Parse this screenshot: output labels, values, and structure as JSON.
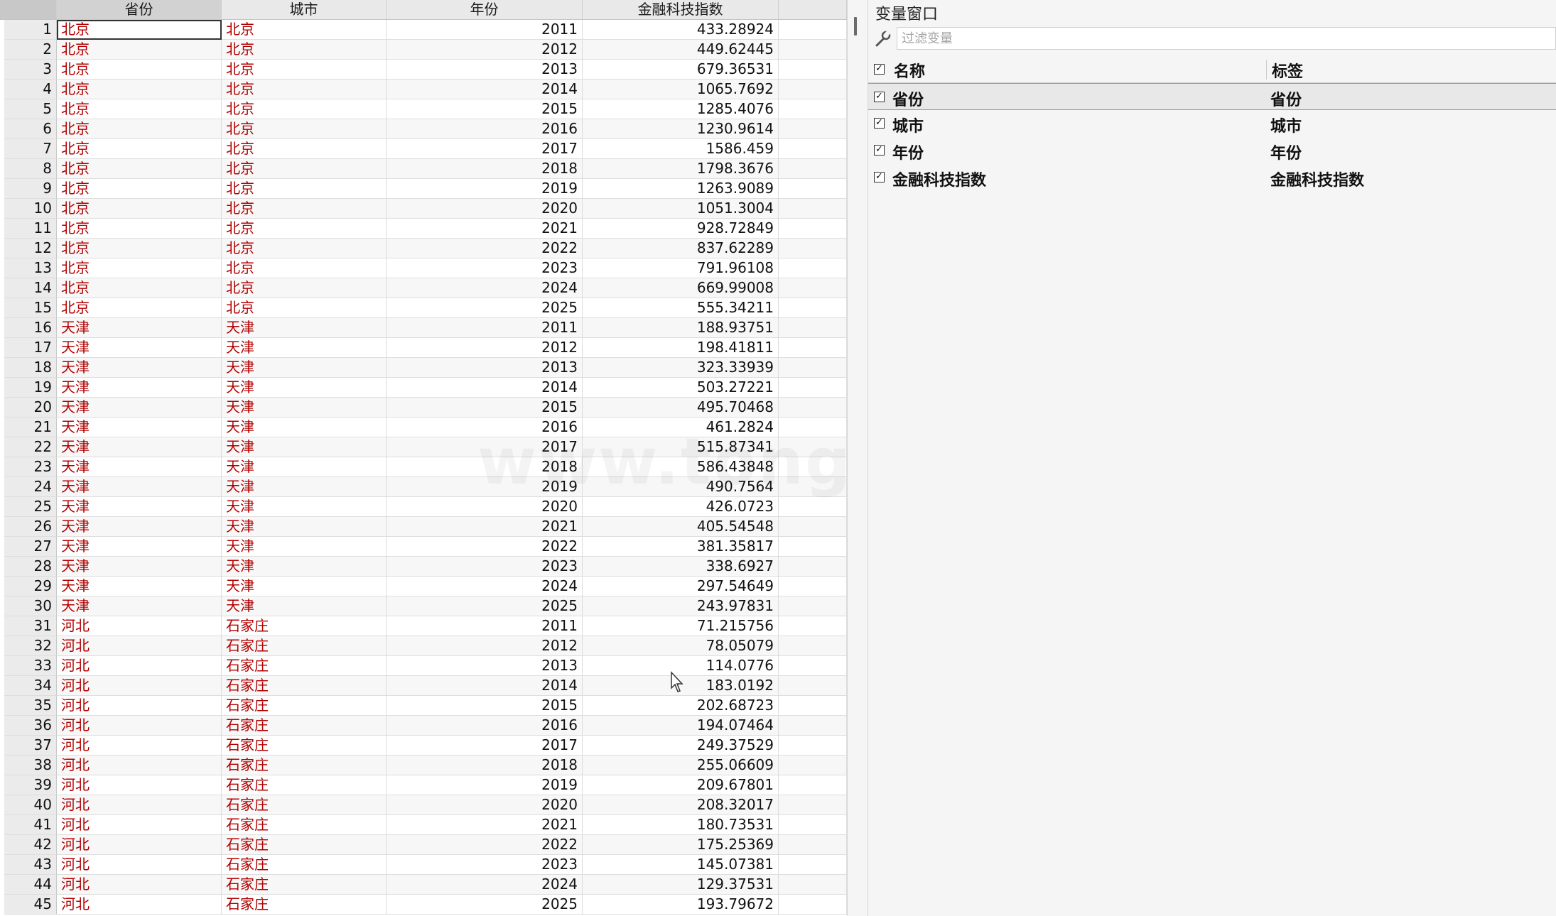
{
  "editor": {
    "columns": [
      "省份",
      "城市",
      "年份",
      "金融科技指数"
    ],
    "rows": [
      [
        "1",
        "北京",
        "北京",
        "2011",
        "433.28924"
      ],
      [
        "2",
        "北京",
        "北京",
        "2012",
        "449.62445"
      ],
      [
        "3",
        "北京",
        "北京",
        "2013",
        "679.36531"
      ],
      [
        "4",
        "北京",
        "北京",
        "2014",
        "1065.7692"
      ],
      [
        "5",
        "北京",
        "北京",
        "2015",
        "1285.4076"
      ],
      [
        "6",
        "北京",
        "北京",
        "2016",
        "1230.9614"
      ],
      [
        "7",
        "北京",
        "北京",
        "2017",
        "1586.459"
      ],
      [
        "8",
        "北京",
        "北京",
        "2018",
        "1798.3676"
      ],
      [
        "9",
        "北京",
        "北京",
        "2019",
        "1263.9089"
      ],
      [
        "10",
        "北京",
        "北京",
        "2020",
        "1051.3004"
      ],
      [
        "11",
        "北京",
        "北京",
        "2021",
        "928.72849"
      ],
      [
        "12",
        "北京",
        "北京",
        "2022",
        "837.62289"
      ],
      [
        "13",
        "北京",
        "北京",
        "2023",
        "791.96108"
      ],
      [
        "14",
        "北京",
        "北京",
        "2024",
        "669.99008"
      ],
      [
        "15",
        "北京",
        "北京",
        "2025",
        "555.34211"
      ],
      [
        "16",
        "天津",
        "天津",
        "2011",
        "188.93751"
      ],
      [
        "17",
        "天津",
        "天津",
        "2012",
        "198.41811"
      ],
      [
        "18",
        "天津",
        "天津",
        "2013",
        "323.33939"
      ],
      [
        "19",
        "天津",
        "天津",
        "2014",
        "503.27221"
      ],
      [
        "20",
        "天津",
        "天津",
        "2015",
        "495.70468"
      ],
      [
        "21",
        "天津",
        "天津",
        "2016",
        "461.2824"
      ],
      [
        "22",
        "天津",
        "天津",
        "2017",
        "515.87341"
      ],
      [
        "23",
        "天津",
        "天津",
        "2018",
        "586.43848"
      ],
      [
        "24",
        "天津",
        "天津",
        "2019",
        "490.7564"
      ],
      [
        "25",
        "天津",
        "天津",
        "2020",
        "426.0723"
      ],
      [
        "26",
        "天津",
        "天津",
        "2021",
        "405.54548"
      ],
      [
        "27",
        "天津",
        "天津",
        "2022",
        "381.35817"
      ],
      [
        "28",
        "天津",
        "天津",
        "2023",
        "338.6927"
      ],
      [
        "29",
        "天津",
        "天津",
        "2024",
        "297.54649"
      ],
      [
        "30",
        "天津",
        "天津",
        "2025",
        "243.97831"
      ],
      [
        "31",
        "河北",
        "石家庄",
        "2011",
        "71.215756"
      ],
      [
        "32",
        "河北",
        "石家庄",
        "2012",
        "78.05079"
      ],
      [
        "33",
        "河北",
        "石家庄",
        "2013",
        "114.0776"
      ],
      [
        "34",
        "河北",
        "石家庄",
        "2014",
        "183.0192"
      ],
      [
        "35",
        "河北",
        "石家庄",
        "2015",
        "202.68723"
      ],
      [
        "36",
        "河北",
        "石家庄",
        "2016",
        "194.07464"
      ],
      [
        "37",
        "河北",
        "石家庄",
        "2017",
        "249.37529"
      ],
      [
        "38",
        "河北",
        "石家庄",
        "2018",
        "255.06609"
      ],
      [
        "39",
        "河北",
        "石家庄",
        "2019",
        "209.67801"
      ],
      [
        "40",
        "河北",
        "石家庄",
        "2020",
        "208.32017"
      ],
      [
        "41",
        "河北",
        "石家庄",
        "2021",
        "180.73531"
      ],
      [
        "42",
        "河北",
        "石家庄",
        "2022",
        "175.25369"
      ],
      [
        "43",
        "河北",
        "石家庄",
        "2023",
        "145.07381"
      ],
      [
        "44",
        "河北",
        "石家庄",
        "2024",
        "129.37531"
      ],
      [
        "45",
        "河北",
        "石家庄",
        "2025",
        "193.79672"
      ]
    ],
    "string_color": "#b20000"
  },
  "variables_window": {
    "title": "变量窗口",
    "filter_placeholder": "过滤变量",
    "filter_icon": "wrench-icon",
    "header": {
      "name": "名称",
      "label": "标签"
    },
    "variables": [
      {
        "name": "省份",
        "label": "省份"
      },
      {
        "name": "城市",
        "label": "城市"
      },
      {
        "name": "年份",
        "label": "年份"
      },
      {
        "name": "金融科技指数",
        "label": "金融科技指数"
      }
    ]
  },
  "watermark": "www.tongdata.cn"
}
